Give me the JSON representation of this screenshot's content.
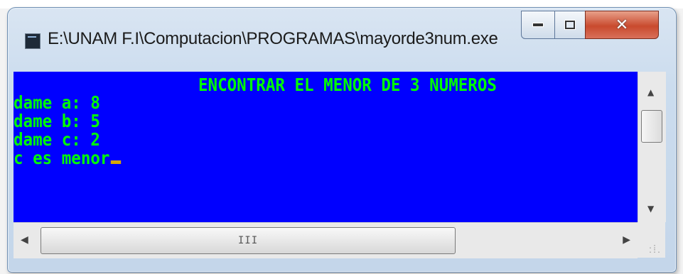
{
  "window": {
    "title": "E:\\UNAM F.I\\Computacion\\PROGRAMAS\\mayorde3num.exe",
    "icon": "console-app-icon",
    "caption_buttons": {
      "minimize": "minimize-icon",
      "maximize": "maximize-icon",
      "close": "close-icon"
    }
  },
  "console": {
    "background": "#0000ff",
    "text_color": "#00ff00",
    "cursor_color": "#d6a800",
    "heading": "ENCONTRAR EL MENOR DE 3 NUMEROS",
    "lines": [
      "dame a: 8",
      "dame b: 5",
      "dame c: 2",
      "c es menor"
    ]
  },
  "scrollbars": {
    "hscroll_grip": "III"
  }
}
